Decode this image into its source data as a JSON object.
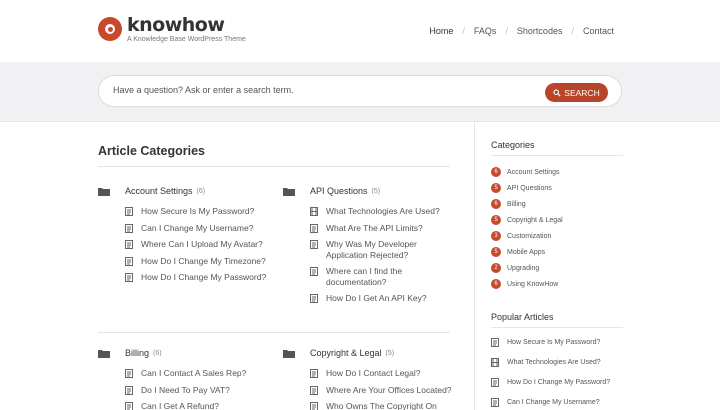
{
  "brand": {
    "name": "knowhow",
    "tagline": "A Knowledge Base WordPress Theme",
    "accent": "#c8482c"
  },
  "nav": [
    {
      "label": "Home",
      "active": true
    },
    {
      "label": "FAQs",
      "active": false
    },
    {
      "label": "Shortcodes",
      "active": false
    },
    {
      "label": "Contact",
      "active": false
    }
  ],
  "search": {
    "placeholder": "Have a question? Ask or enter a search term.",
    "button": "SEARCH"
  },
  "main": {
    "title": "Article Categories",
    "categories": [
      {
        "name": "Account Settings",
        "count": "(6)",
        "articles": [
          "How Secure Is My Password?",
          "Can I Change My Username?",
          "Where Can I Upload My Avatar?",
          "How Do I Change My Timezone?",
          "How Do I Change My Password?"
        ]
      },
      {
        "name": "API Questions",
        "count": "(5)",
        "articles": [
          "What Technologies Are Used?",
          "What Are The API Limits?",
          "Why Was My Developer Application Rejected?",
          "Where can I find the documentation?",
          "How Do I Get An API Key?"
        ]
      },
      {
        "name": "Billing",
        "count": "(6)",
        "articles": [
          "Can I Contact A Sales Rep?",
          "Do I Need To Pay VAT?",
          "Can I Get A Refund?"
        ]
      },
      {
        "name": "Copyright & Legal",
        "count": "(5)",
        "articles": [
          "How Do I Contact Legal?",
          "Where Are Your Offices Located?",
          "Who Owns The Copyright On"
        ]
      }
    ]
  },
  "sidebar": {
    "categories_title": "Categories",
    "categories": [
      {
        "count": "6",
        "label": "Account Settings"
      },
      {
        "count": "5",
        "label": "API Questions"
      },
      {
        "count": "6",
        "label": "Billing"
      },
      {
        "count": "5",
        "label": "Copyright & Legal"
      },
      {
        "count": "3",
        "label": "Customization"
      },
      {
        "count": "5",
        "label": "Mobile Apps"
      },
      {
        "count": "2",
        "label": "Upgrading"
      },
      {
        "count": "6",
        "label": "Using KnowHow"
      }
    ],
    "popular_title": "Popular Articles",
    "popular": [
      {
        "label": "How Secure Is My Password?",
        "icon": "document-icon"
      },
      {
        "label": "What Technologies Are Used?",
        "icon": "video-icon"
      },
      {
        "label": "How Do I Change My Password?",
        "icon": "document-icon"
      },
      {
        "label": "Can I Change My Username?",
        "icon": "document-icon"
      }
    ]
  }
}
